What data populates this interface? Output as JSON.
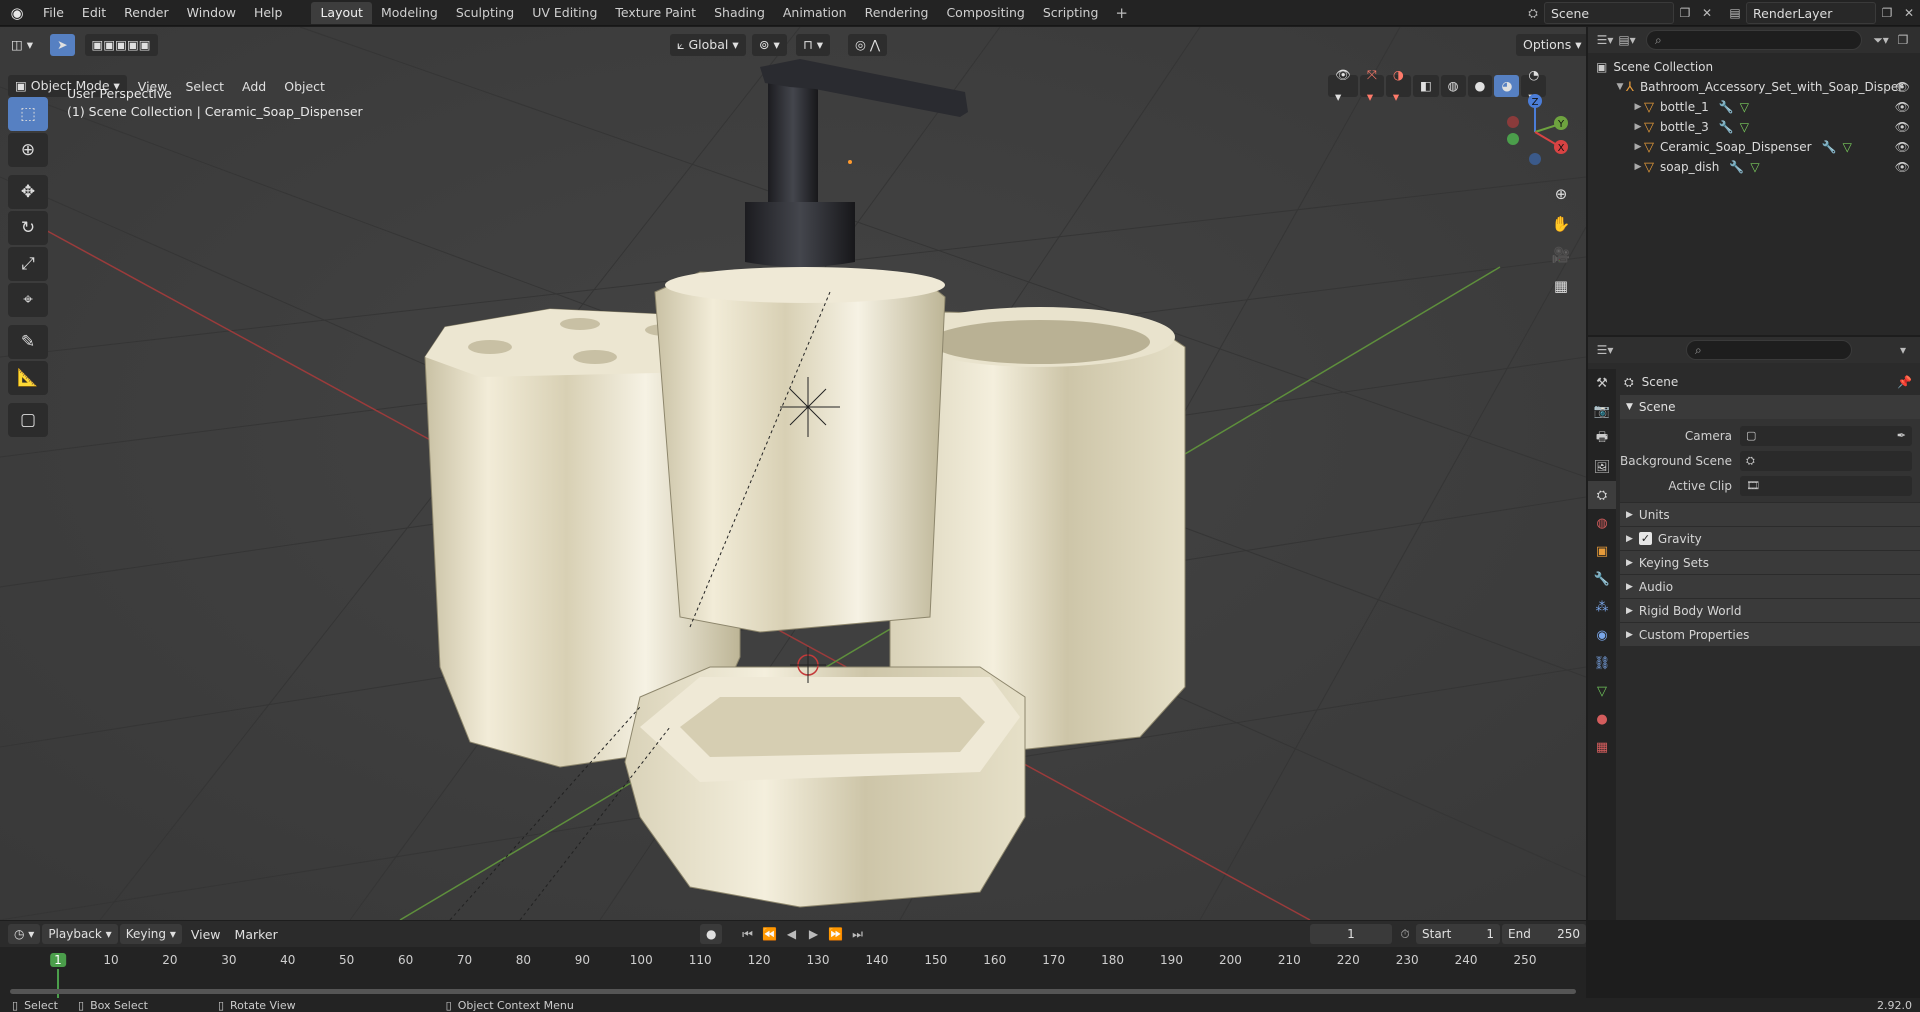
{
  "topbar": {
    "menus": [
      "File",
      "Edit",
      "Render",
      "Window",
      "Help"
    ],
    "tabs": [
      "Layout",
      "Modeling",
      "Sculpting",
      "UV Editing",
      "Texture Paint",
      "Shading",
      "Animation",
      "Rendering",
      "Compositing",
      "Scripting"
    ],
    "active_tab": "Layout",
    "scene_name": "Scene",
    "render_layer": "RenderLayer"
  },
  "viewport": {
    "mode": "Object Mode",
    "menus": [
      "View",
      "Select",
      "Add",
      "Object"
    ],
    "transform_orientation": "Global",
    "options_label": "Options",
    "perspective_label": "User Perspective",
    "context_label": "(1) Scene Collection | Ceramic_Soap_Dispenser",
    "gizmo": {
      "x": "X",
      "y": "Y",
      "z": "Z"
    }
  },
  "outliner": {
    "root": "Scene Collection",
    "collection": "Bathroom_Accessory_Set_with_Soap_Disper",
    "objects": [
      "bottle_1",
      "bottle_3",
      "Ceramic_Soap_Dispenser",
      "soap_dish"
    ]
  },
  "properties": {
    "header": "Scene",
    "panel": "Scene",
    "fields": [
      {
        "label": "Camera"
      },
      {
        "label": "Background Scene"
      },
      {
        "label": "Active Clip"
      }
    ],
    "subpanels": [
      "Units",
      "Gravity",
      "Keying Sets",
      "Audio",
      "Rigid Body World",
      "Custom Properties"
    ]
  },
  "timeline": {
    "playback_label": "Playback",
    "keying_label": "Keying",
    "view_label": "View",
    "marker_label": "Marker",
    "current_frame": "1",
    "start_label": "Start",
    "start_value": "1",
    "end_label": "End",
    "end_value": "250",
    "ticks": [
      "1",
      "10",
      "20",
      "30",
      "40",
      "50",
      "60",
      "70",
      "80",
      "90",
      "100",
      "110",
      "120",
      "130",
      "140",
      "150",
      "160",
      "170",
      "180",
      "190",
      "200",
      "210",
      "220",
      "230",
      "240",
      "250"
    ]
  },
  "statusbar": {
    "select": "Select",
    "box_select": "Box Select",
    "rotate_view": "Rotate View",
    "context_menu": "Object Context Menu",
    "version": "2.92.0"
  }
}
